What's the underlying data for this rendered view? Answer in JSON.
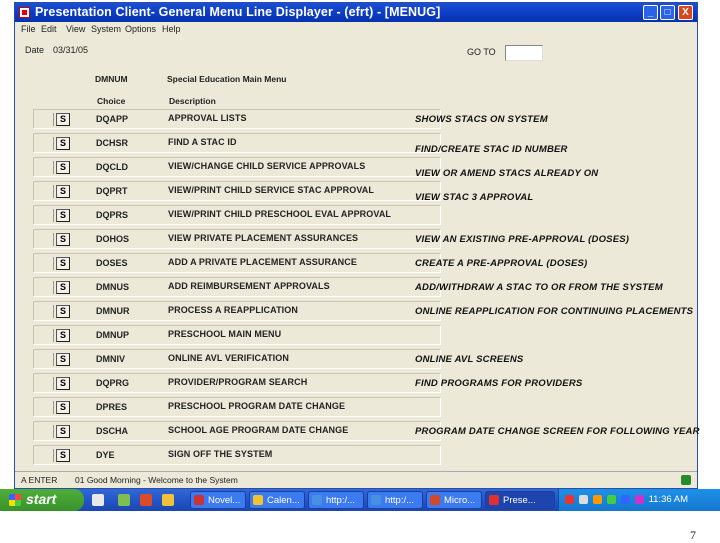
{
  "window": {
    "title": "Presentation Client- General Menu Line Displayer - (efrt) - [MENUG]",
    "min_glyph": "_",
    "max_glyph": "□",
    "close_glyph": "X"
  },
  "menubar": [
    "File",
    "Edit",
    "View",
    "System",
    "Options",
    "Help"
  ],
  "form": {
    "date_label": "Date",
    "date_value": "03/31/05",
    "goto_label": "GO TO",
    "goto_value": "",
    "dmnum_label": "DMNUM",
    "menu_title": "Special Education Main Menu",
    "col_choice": "Choice",
    "col_description": "Description",
    "select_glyph": "S"
  },
  "rows": [
    {
      "code": "DQAPP",
      "desc": "APPROVAL LISTS"
    },
    {
      "code": "DCHSR",
      "desc": "FIND A STAC ID"
    },
    {
      "code": "DQCLD",
      "desc": "VIEW/CHANGE CHILD SERVICE APPROVALS"
    },
    {
      "code": "DQPRT",
      "desc": "VIEW/PRINT CHILD SERVICE STAC APPROVAL"
    },
    {
      "code": "DQPRS",
      "desc": "VIEW/PRINT CHILD PRESCHOOL EVAL APPROVAL"
    },
    {
      "code": "DOHOS",
      "desc": "VIEW PRIVATE PLACEMENT ASSURANCES"
    },
    {
      "code": "DOSES",
      "desc": "ADD A PRIVATE PLACEMENT ASSURANCE"
    },
    {
      "code": "DMNUS",
      "desc": "ADD REIMBURSEMENT APPROVALS"
    },
    {
      "code": "DMNUR",
      "desc": "PROCESS A REAPPLICATION"
    },
    {
      "code": "DMNUP",
      "desc": "PRESCHOOL MAIN MENU"
    },
    {
      "code": "DMNIV",
      "desc": "ONLINE AVL VERIFICATION"
    },
    {
      "code": "DQPRG",
      "desc": "PROVIDER/PROGRAM SEARCH"
    },
    {
      "code": "DPRES",
      "desc": "PRESCHOOL PROGRAM DATE CHANGE"
    },
    {
      "code": "DSCHA",
      "desc": "SCHOOL AGE PROGRAM DATE CHANGE"
    },
    {
      "code": "DYE",
      "desc": "SIGN OFF THE SYSTEM"
    }
  ],
  "notes": [
    "SHOWS STACS ON SYSTEM",
    "FIND/CREATE STAC ID NUMBER",
    "VIEW OR AMEND STACS ALREADY ON",
    "VIEW STAC 3 APPROVAL",
    "VIEW AN EXISTING PRE-APPROVAL (DOSES)",
    "CREATE A PRE-APPROVAL (DOSES)",
    "ADD/WITHDRAW A STAC TO OR FROM THE SYSTEM",
    "ONLINE REAPPLICATION FOR CONTINUING PLACEMENTS",
    "ONLINE AVL SCREENS",
    "FIND PROGRAMS FOR PROVIDERS",
    "PROGRAM DATE CHANGE SCREEN FOR FOLLOWING YEAR"
  ],
  "statusbar": {
    "left": "A ENTER",
    "message": "01 Good Morning - Welcome to the System"
  },
  "taskbar": {
    "start_label": "start",
    "tasks": [
      "Novel...",
      "Calen...",
      "http:/...",
      "http:/...",
      "Micro...",
      "Prese..."
    ],
    "clock": "11:36 AM"
  },
  "page_number": "7",
  "colors": {
    "titlebar": "#0a3bc2",
    "window_bg": "#ece9d8",
    "taskbar": "#2456c7",
    "start": "#39922b"
  }
}
